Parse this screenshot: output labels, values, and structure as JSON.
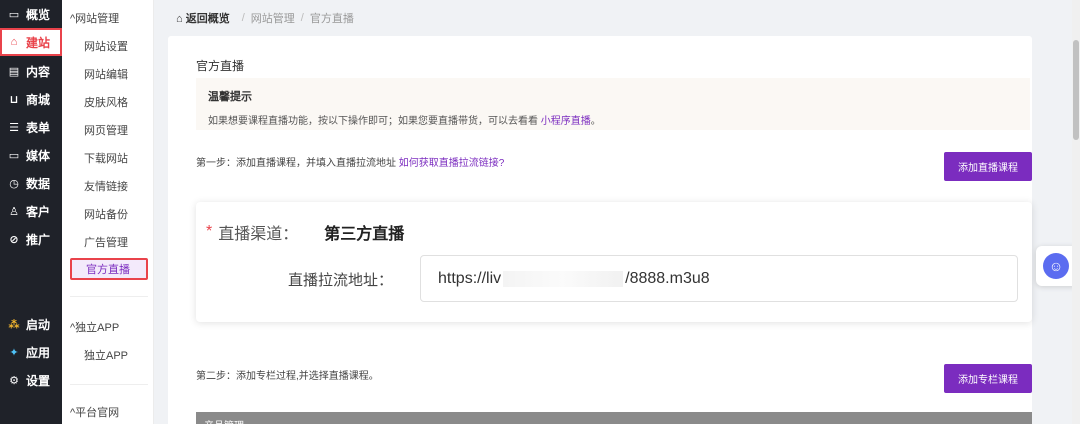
{
  "nav": {
    "items": [
      {
        "icon": "overview-icon",
        "glyph": "▭",
        "label": "概览"
      },
      {
        "icon": "home-icon",
        "glyph": "⌂",
        "label": "建站",
        "active": true
      },
      {
        "icon": "content-icon",
        "glyph": "▤",
        "label": "内容"
      },
      {
        "icon": "cart-icon",
        "glyph": "⊔",
        "label": "商城"
      },
      {
        "icon": "form-icon",
        "glyph": "☰",
        "label": "表单"
      },
      {
        "icon": "media-icon",
        "glyph": "▭",
        "label": "媒体"
      },
      {
        "icon": "data-icon",
        "glyph": "◷",
        "label": "数据"
      },
      {
        "icon": "user-icon",
        "glyph": "♙",
        "label": "客户"
      },
      {
        "icon": "link-icon",
        "glyph": "⊘",
        "label": "推广"
      }
    ],
    "bottom": [
      {
        "icon": "launch-icon",
        "glyph": "⁂",
        "label": "启动"
      },
      {
        "icon": "apps-icon",
        "glyph": "✦",
        "label": "应用"
      },
      {
        "icon": "settings-icon",
        "glyph": "⚙",
        "label": "设置"
      }
    ],
    "colors": {
      "bg": "#1f2229",
      "active": "#e9434b"
    }
  },
  "sub": {
    "group1": "网站管理",
    "group1_items": [
      "网站设置",
      "网站编辑",
      "皮肤风格",
      "网页管理",
      "下载网站",
      "友情链接",
      "网站备份",
      "广告管理"
    ],
    "active_item": "官方直播",
    "group2": "独立APP",
    "group2_items": [
      "独立APP"
    ],
    "group3": "平台官网"
  },
  "breadcrumb": {
    "home": "返回概览",
    "level1": "网站管理",
    "level2": "官方直播"
  },
  "main": {
    "title": "官方直播",
    "tip_title": "温馨提示",
    "tip_text": "如果想要课程直播功能，按以下操作即可；如果您要直播带货，可以去看看",
    "tip_link": "小程序直播",
    "tip_end": "。",
    "step1_text": "第一步：添加直播课程，并填入直播拉流地址",
    "step1_link": "如何获取直播拉流链接?",
    "step1_button": "添加直播课程",
    "channel_label": "直播渠道：",
    "channel_value": "第三方直播",
    "url_label": "直播拉流地址：",
    "url_prefix": "https://liv",
    "url_suffix": "/8888.m3u8",
    "step2_text": "第二步：添加专栏过程,并选择直播课程。",
    "step2_button": "添加专栏课程",
    "strip_text": "产品管理"
  },
  "colors": {
    "accent": "#7b2cbf",
    "required": "#e9434b"
  }
}
